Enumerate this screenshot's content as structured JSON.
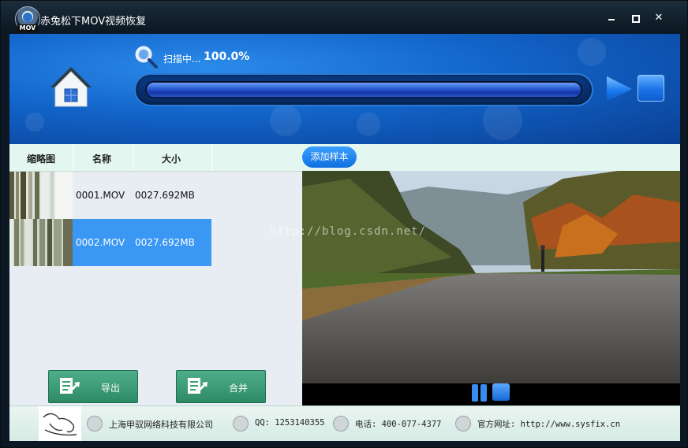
{
  "window": {
    "title": "赤兔松下MOV视频恢复",
    "logo_text": "MOV",
    "controls": {
      "minimize": "minimize",
      "maximize": "maximize",
      "close": "✕"
    }
  },
  "scan": {
    "label": "扫描中...",
    "percent": "100.0%",
    "progress_fraction": 1.0
  },
  "table": {
    "columns": [
      "缩略图",
      "名称",
      "大小"
    ],
    "add_sample_label": "添加样本",
    "rows": [
      {
        "name": "0001.MOV",
        "size": "0027.692MB",
        "selected": false
      },
      {
        "name": "0002.MOV",
        "size": "0027.692MB",
        "selected": true
      }
    ]
  },
  "actions": {
    "export_label": "导出",
    "merge_label": "合并"
  },
  "footer": {
    "company": "上海甲驭网络科技有限公司",
    "qq": "QQ: 1253140355",
    "phone": "电话: 400-077-4377",
    "website": "官方网址: http://www.sysfix.cn"
  },
  "watermark": "http://blog.csdn.net/",
  "colors": {
    "accent_blue": "#1a73e8",
    "selected_row": "#3a97f3",
    "button_green": "#3a9d78",
    "header_bg": "#1263c8"
  },
  "icons": [
    "home-icon",
    "search-icon",
    "play-icon",
    "stop-icon",
    "export-icon",
    "merge-icon",
    "pause-icon",
    "company-icon",
    "qq-icon",
    "phone-icon",
    "globe-icon"
  ]
}
